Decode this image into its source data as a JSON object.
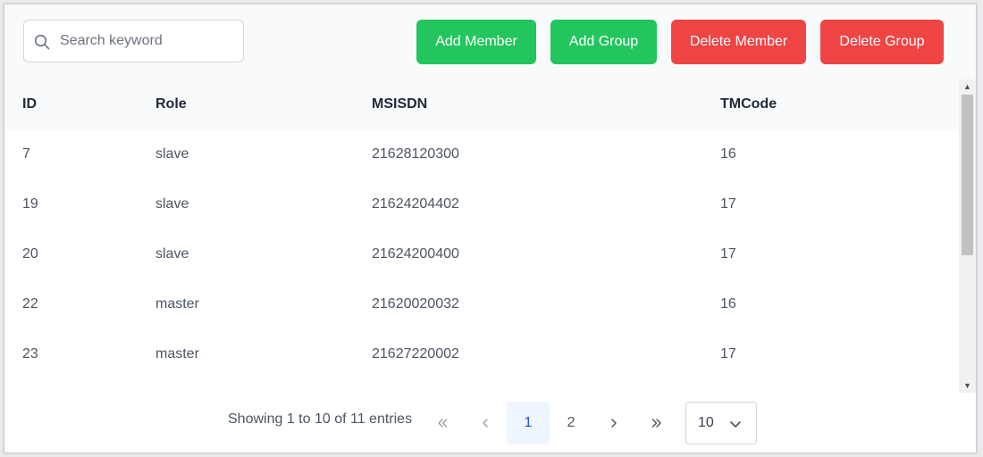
{
  "toolbar": {
    "search_placeholder": "Search keyword",
    "search_value": "",
    "buttons": {
      "add_member": "Add Member",
      "add_group": "Add Group",
      "delete_member": "Delete Member",
      "delete_group": "Delete Group"
    },
    "colors": {
      "green": "#22c55e",
      "red": "#ef4444"
    }
  },
  "table": {
    "columns": [
      "ID",
      "Role",
      "MSISDN",
      "TMCode"
    ],
    "rows": [
      [
        "7",
        "slave",
        "21628120300",
        "16"
      ],
      [
        "19",
        "slave",
        "21624204402",
        "17"
      ],
      [
        "20",
        "slave",
        "21624200400",
        "17"
      ],
      [
        "22",
        "master",
        "21620020032",
        "16"
      ],
      [
        "23",
        "master",
        "21627220002",
        "17"
      ]
    ]
  },
  "pagination": {
    "info": "Showing 1 to 10 of 11 entries",
    "pages": [
      "1",
      "2"
    ],
    "current_page": "1",
    "page_size": "10",
    "icons": {
      "first": "chevrons-left-icon",
      "prev": "chevron-left-icon",
      "next": "chevron-right-icon",
      "last": "chevrons-right-icon"
    }
  }
}
